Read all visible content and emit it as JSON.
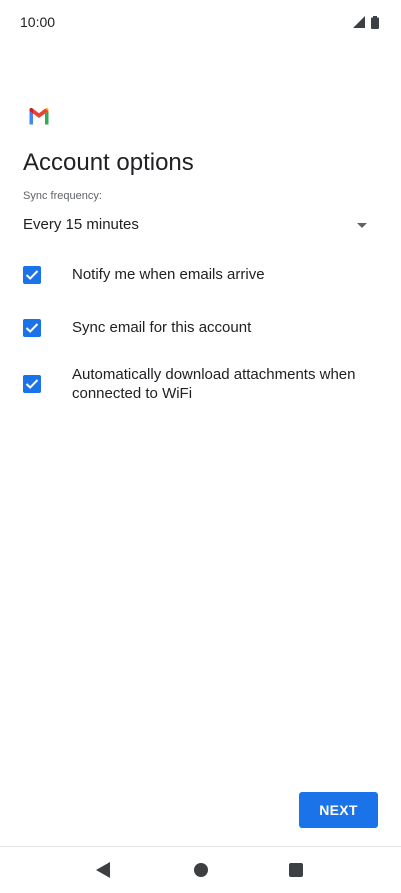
{
  "status_bar": {
    "time": "10:00",
    "icons": [
      "signal-icon",
      "battery-icon"
    ]
  },
  "header": {
    "logo_icon": "gmail-logo-icon",
    "title": "Account options"
  },
  "sync": {
    "label": "Sync frequency:",
    "selected_value": "Every 15 minutes"
  },
  "options": [
    {
      "label": "Notify me when emails arrive",
      "checked": true
    },
    {
      "label": "Sync email for this account",
      "checked": true
    },
    {
      "label": "Automatically download attachments when connected to WiFi",
      "checked": true
    }
  ],
  "footer": {
    "next_label": "NEXT"
  },
  "nav": {
    "icons": [
      "back-icon",
      "home-icon",
      "recents-icon"
    ]
  },
  "colors": {
    "accent": "#1a73e8",
    "text": "#202124",
    "secondary_text": "#5f6368"
  }
}
